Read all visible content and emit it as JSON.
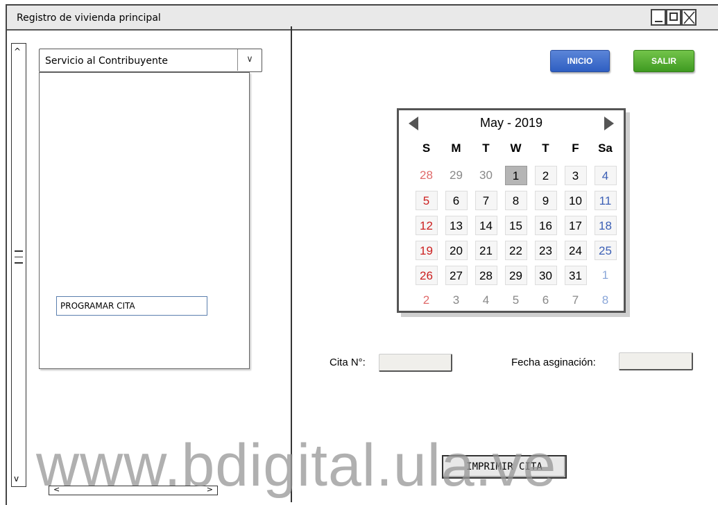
{
  "window": {
    "title": "Registro de vivienda principal"
  },
  "left_panel": {
    "combo_value": "Servicio al Contribuyente",
    "list_items": [
      "PROGRAMAR CITA"
    ]
  },
  "toolbar": {
    "inicio_label": "INICIO",
    "salir_label": "SALIR",
    "colors": {
      "inicio": "#3a6ccf",
      "salir": "#4fae2c"
    }
  },
  "calendar": {
    "title": "May - 2019",
    "weekdays": [
      "S",
      "M",
      "T",
      "W",
      "T",
      "F",
      "Sa"
    ],
    "weeks": [
      [
        "28",
        "29",
        "30",
        "1",
        "2",
        "3",
        "4"
      ],
      [
        "5",
        "6",
        "7",
        "8",
        "9",
        "10",
        "11"
      ],
      [
        "12",
        "13",
        "14",
        "15",
        "16",
        "17",
        "18"
      ],
      [
        "19",
        "20",
        "21",
        "22",
        "23",
        "24",
        "25"
      ],
      [
        "26",
        "27",
        "28",
        "29",
        "30",
        "31",
        "1"
      ],
      [
        "2",
        "3",
        "4",
        "5",
        "6",
        "7",
        "8"
      ]
    ],
    "selected_day": "1"
  },
  "form": {
    "cita_label": "Cita N°:",
    "cita_value": "",
    "fecha_label": "Fecha asginación:",
    "fecha_value": ""
  },
  "actions": {
    "print_label": "IMPRIMIR CITA"
  },
  "watermark": "www.bdigital.ula.ve"
}
